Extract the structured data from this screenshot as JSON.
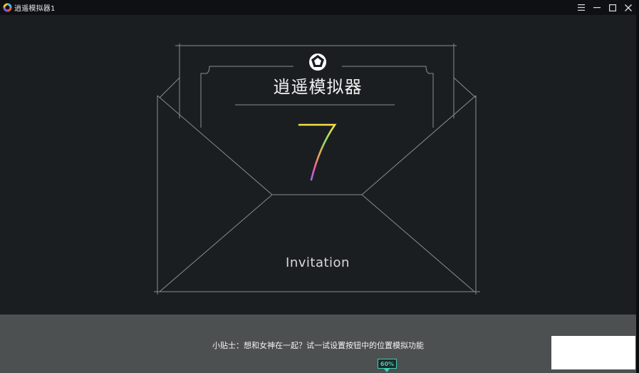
{
  "window": {
    "title": "逍遥模拟器1",
    "controls": [
      "menu-icon",
      "minimize-icon",
      "maximize-icon",
      "close-icon"
    ]
  },
  "splash": {
    "logo_name": "逍遥模拟器",
    "version_number": "7",
    "invitation_label": "Invitation"
  },
  "footer": {
    "tip_text": "小贴士：想和女神在一起？试一试设置按钮中的位置模拟功能",
    "progress_label": "60%",
    "progress_value": 0.6
  },
  "colors": {
    "background": "#1b1e21",
    "footer_background": "#4d5051",
    "accent": "#3ecfb3"
  }
}
